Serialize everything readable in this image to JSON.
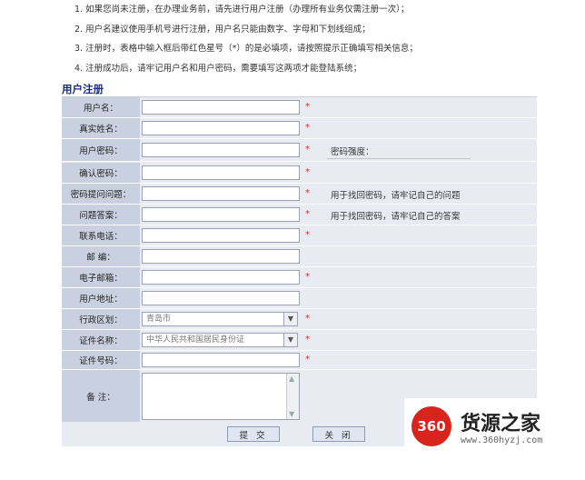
{
  "notes": [
    "1. 如果您尚未注册，在办理业务前，请先进行用户注册（办理所有业务仅需注册一次）；",
    "2. 用户名建议使用手机号进行注册，用户名只能由数字、字母和下划线组成；",
    "3. 注册时，表格中输入框后带红色星号（*）的是必填项，请按照提示正确填写相关信息；",
    "4. 注册成功后，请牢记用户名和用户密码，需要填写这两项才能登陆系统；"
  ],
  "section_title": "用户注册",
  "required_mark": "*",
  "fields": {
    "username": {
      "label": "用户名：",
      "value": ""
    },
    "realname": {
      "label": "真实姓名：",
      "value": ""
    },
    "password": {
      "label": "用户密码：",
      "value": "",
      "hint": "密码强度："
    },
    "confirm": {
      "label": "确认密码：",
      "value": ""
    },
    "question": {
      "label": "密码提问问题：",
      "value": "",
      "hint": "用于找回密码，请牢记自己的问题"
    },
    "answer": {
      "label": "问题答案：",
      "value": "",
      "hint": "用于找回密码，请牢记自己的答案"
    },
    "phone": {
      "label": "联系电话：",
      "value": ""
    },
    "postcode": {
      "label": "邮 编：",
      "value": ""
    },
    "email": {
      "label": "电子邮箱：",
      "value": ""
    },
    "address": {
      "label": "用户地址：",
      "value": ""
    },
    "region": {
      "label": "行政区划：",
      "selected": "青岛市"
    },
    "idtype": {
      "label": "证件名称：",
      "selected": "中华人民共和国居民身份证"
    },
    "idnumber": {
      "label": "证件号码：",
      "value": ""
    },
    "remark": {
      "label": "备 注：",
      "value": ""
    }
  },
  "buttons": {
    "submit": "提 交",
    "close": "关 闭"
  },
  "watermark": {
    "number": "360",
    "title": "货源之家",
    "url": "www.360hyzj.com"
  },
  "colors": {
    "label_bg": "#c9d1e0",
    "form_bg": "#e8ecf2",
    "required": "#d23030",
    "title": "#1a2f7a",
    "logo_red": "#d9231d"
  }
}
